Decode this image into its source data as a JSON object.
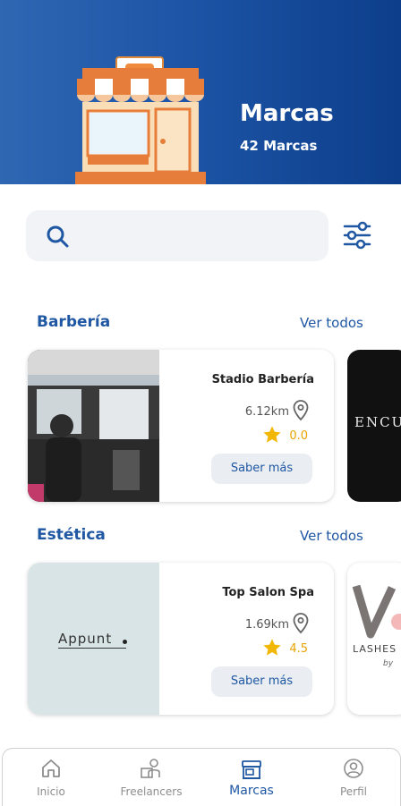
{
  "header": {
    "title": "Marcas",
    "subtitle": "42 Marcas"
  },
  "search": {
    "placeholder": ""
  },
  "sections": [
    {
      "title": "Barbería",
      "see_all": "Ver todos",
      "card": {
        "name": "Stadio Barbería",
        "distance": "6.12km",
        "rating": "0.0",
        "button": "Saber más"
      },
      "peek_text": "ENCU"
    },
    {
      "title": "Estética",
      "see_all": "Ver todos",
      "card": {
        "name": "Top Salon Spa",
        "distance": "1.69km",
        "rating": "4.5",
        "button": "Saber más",
        "logo_text": "Appunt"
      },
      "peek_text": "LASHES",
      "peek_sub": "by"
    }
  ],
  "nav": {
    "items": [
      {
        "label": "Inicio",
        "icon": "home-icon"
      },
      {
        "label": "Freelancers",
        "icon": "freelancers-icon"
      },
      {
        "label": "Marcas",
        "icon": "store-icon",
        "active": true
      },
      {
        "label": "Perfil",
        "icon": "profile-icon"
      }
    ]
  },
  "colors": {
    "primary": "#1f57a3",
    "header_dark": "#0c3e8b",
    "star": "#f2b705"
  }
}
